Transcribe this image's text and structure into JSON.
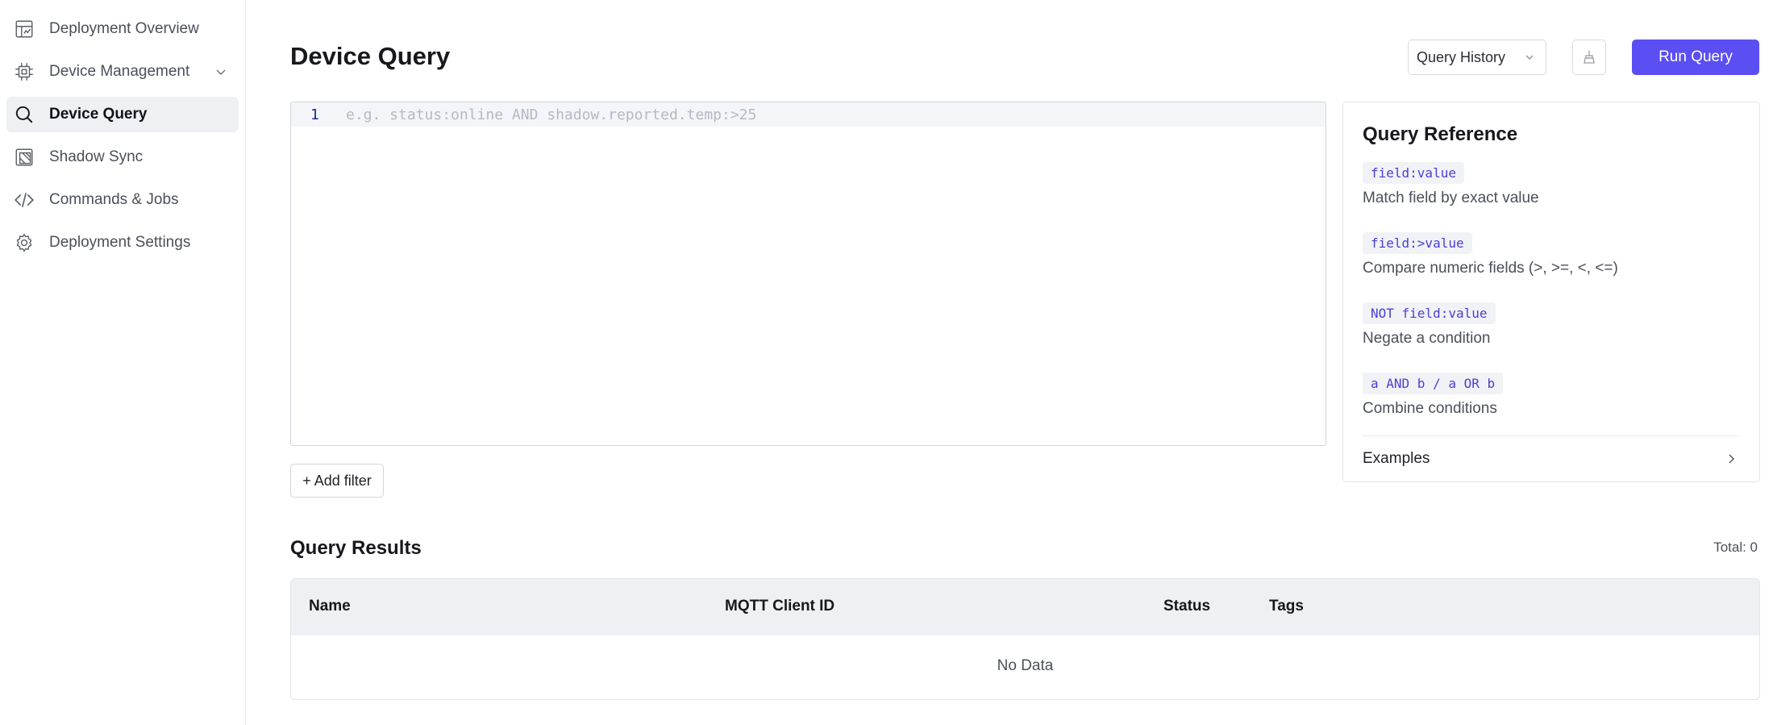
{
  "sidebar": {
    "items": [
      {
        "label": "Deployment Overview",
        "icon": "dashboard-icon",
        "active": false
      },
      {
        "label": "Device Management",
        "icon": "chip-icon",
        "active": false,
        "expandable": true
      },
      {
        "label": "Device Query",
        "icon": "search-icon",
        "active": true
      },
      {
        "label": "Shadow Sync",
        "icon": "sync-frame-icon",
        "active": false
      },
      {
        "label": "Commands & Jobs",
        "icon": "code-icon",
        "active": false
      },
      {
        "label": "Deployment Settings",
        "icon": "gear-icon",
        "active": false
      }
    ]
  },
  "header": {
    "title": "Device Query",
    "history_label": "Query History",
    "clear_icon": "broom-icon",
    "run_label": "Run Query"
  },
  "editor": {
    "line_number": "1",
    "placeholder": "e.g. status:online AND shadow.reported.temp:>25",
    "add_filter_label": "+ Add filter"
  },
  "reference": {
    "title": "Query Reference",
    "items": [
      {
        "code": "field:value",
        "desc": "Match field by exact value"
      },
      {
        "code": "field:>value",
        "desc": "Compare numeric fields (>, >=, <, <=)"
      },
      {
        "code": "NOT field:value",
        "desc": "Negate a condition"
      },
      {
        "code": "a AND b / a OR b",
        "desc": "Combine conditions"
      }
    ],
    "examples_label": "Examples"
  },
  "results": {
    "title": "Query Results",
    "total": "Total: 0",
    "columns": [
      "Name",
      "MQTT Client ID",
      "Status",
      "Tags"
    ],
    "empty_text": "No Data"
  },
  "colors": {
    "accent": "#5b4ef2",
    "code_text": "#4a3fd6",
    "active_nav_bg": "#eef0f4"
  }
}
